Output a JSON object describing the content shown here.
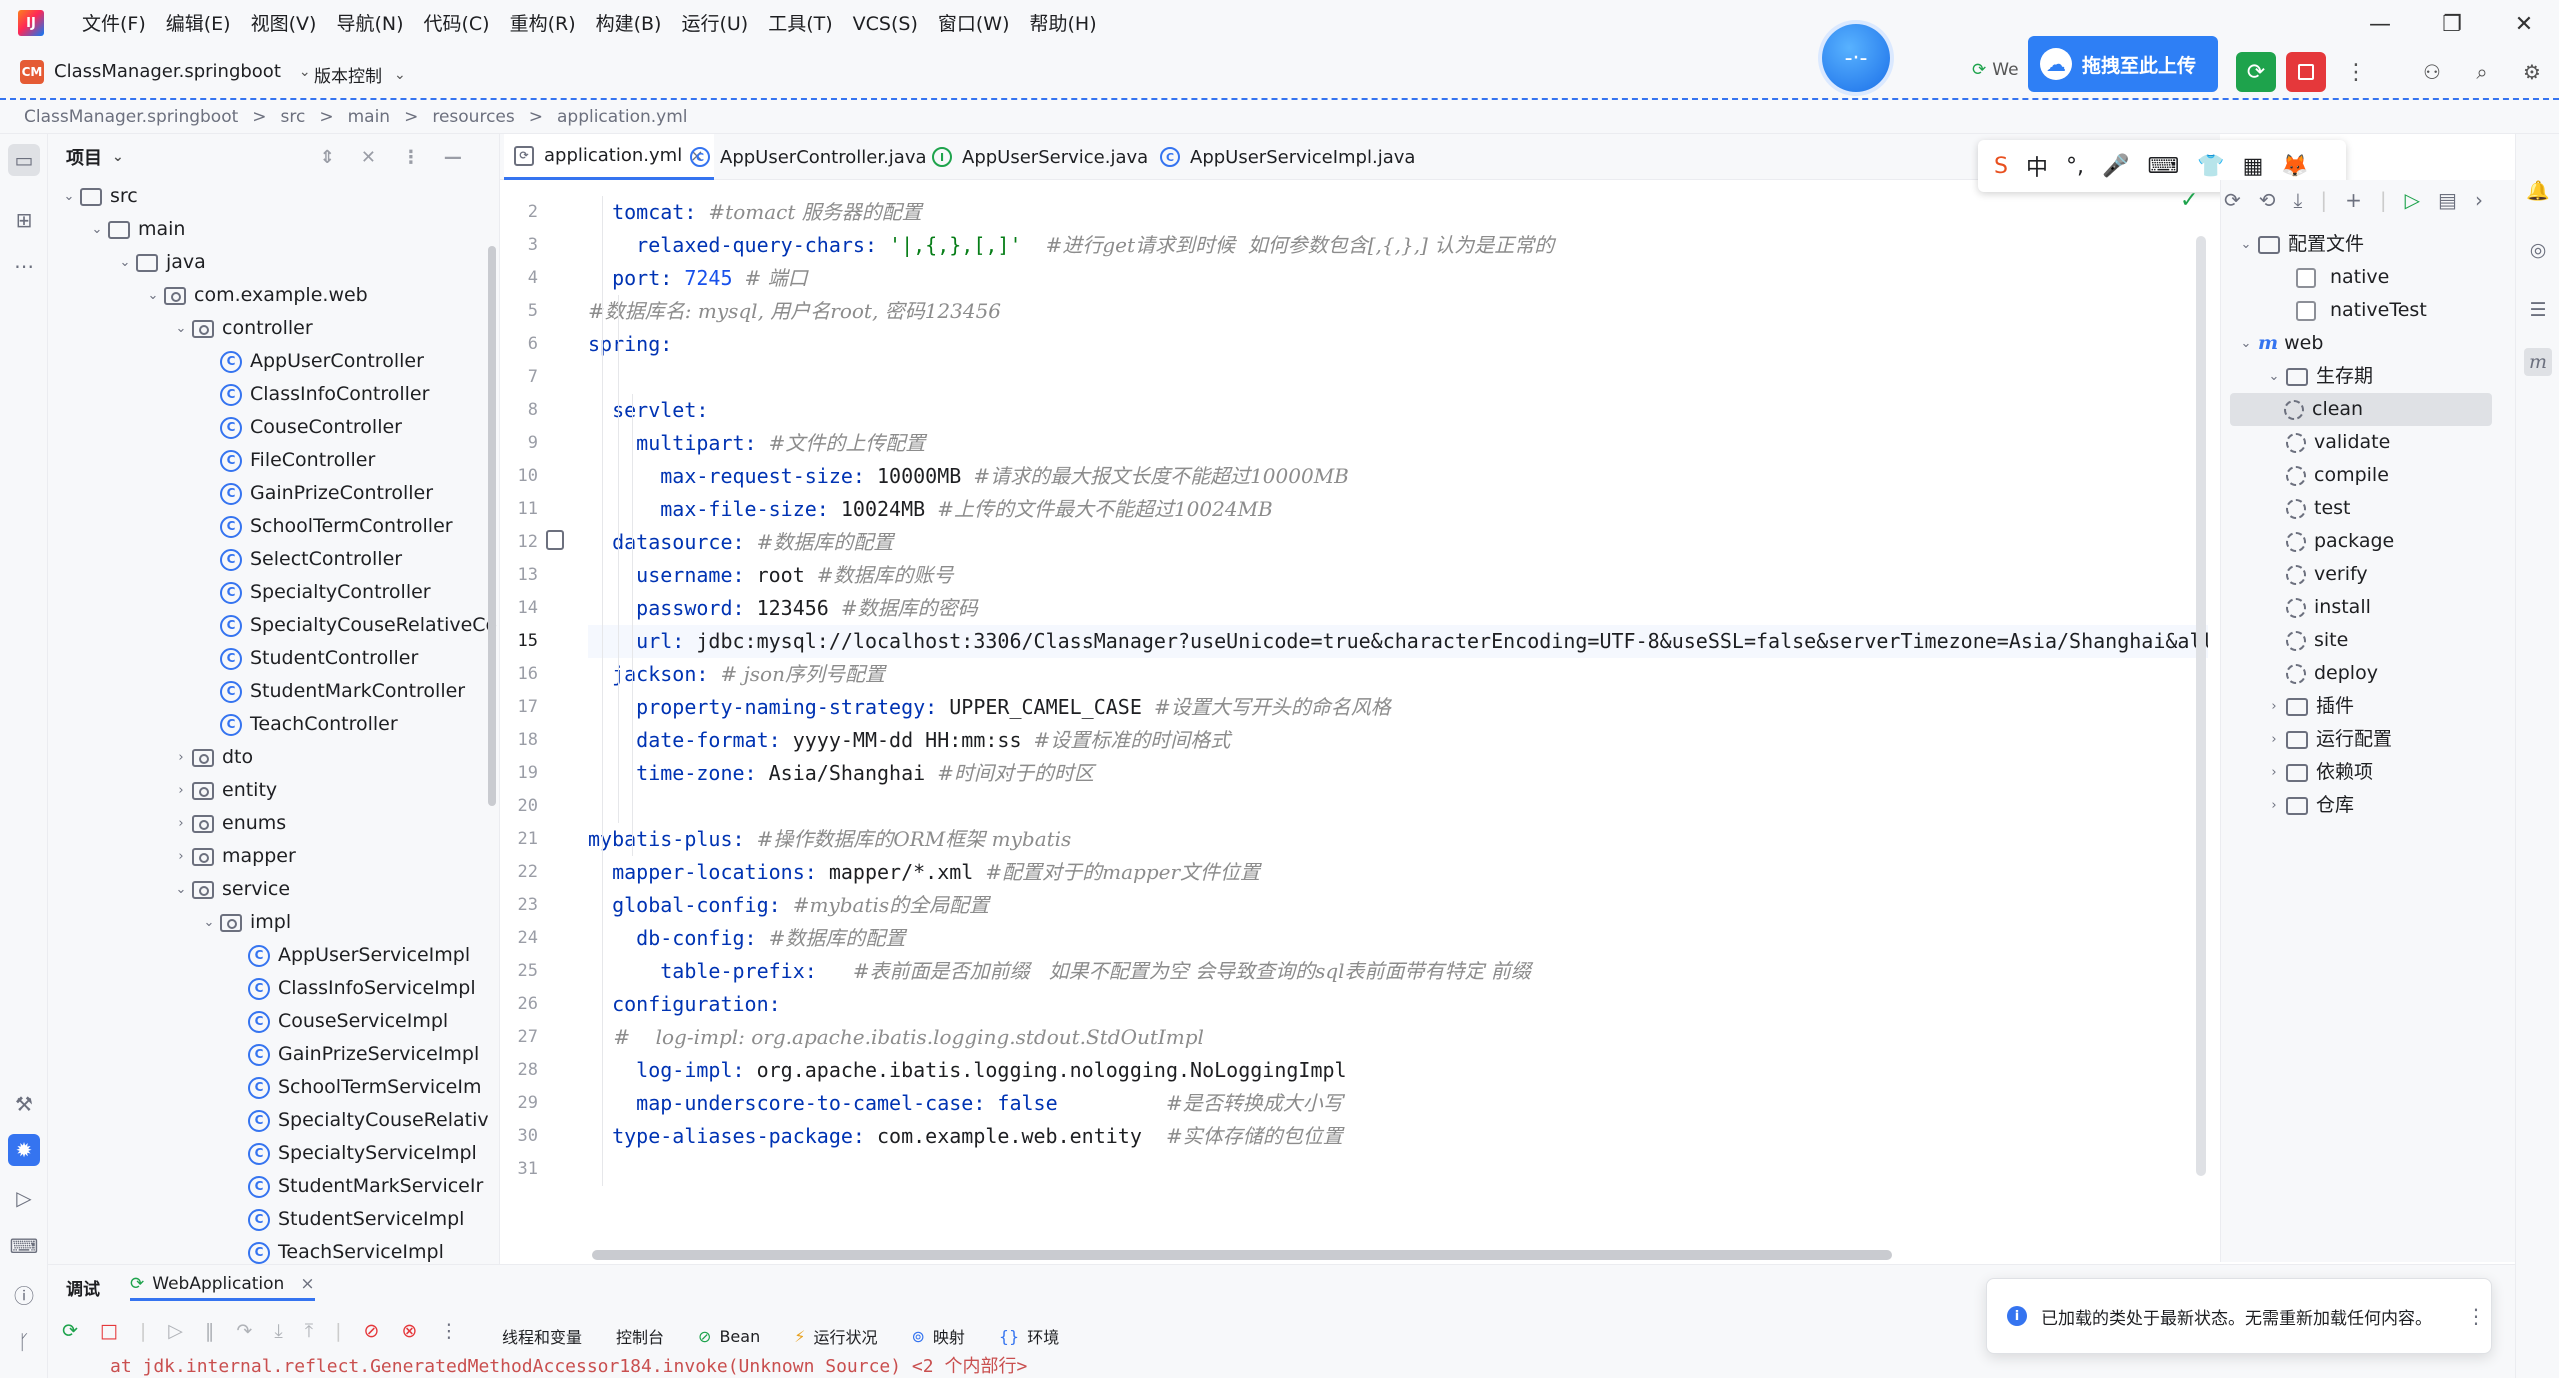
{
  "menubar": {
    "items": [
      "文件(F)",
      "编辑(E)",
      "视图(V)",
      "导航(N)",
      "代码(C)",
      "重构(R)",
      "构建(B)",
      "运行(U)",
      "工具(T)",
      "VCS(S)",
      "窗口(W)",
      "帮助(H)"
    ]
  },
  "toolbar": {
    "project_badge": "CM",
    "project_name": "ClassManager.springboot",
    "vcs_label": "版本控制",
    "run_config_partial": "We",
    "baidu_label": "拖拽至此上传",
    "float_ball_text": "-·-"
  },
  "breadcrumb": [
    "ClassManager.springboot",
    "src",
    "main",
    "resources",
    "application.yml"
  ],
  "project_panel": {
    "title": "项目",
    "tree": [
      {
        "label": "src",
        "depth": 0,
        "kind": "folder",
        "arrow": "open"
      },
      {
        "label": "main",
        "depth": 1,
        "kind": "folder",
        "arrow": "open"
      },
      {
        "label": "java",
        "depth": 2,
        "kind": "folder",
        "arrow": "open"
      },
      {
        "label": "com.example.web",
        "depth": 3,
        "kind": "pkg",
        "arrow": "open"
      },
      {
        "label": "controller",
        "depth": 4,
        "kind": "pkg",
        "arrow": "open"
      },
      {
        "label": "AppUserController",
        "depth": 5,
        "kind": "class"
      },
      {
        "label": "ClassInfoController",
        "depth": 5,
        "kind": "class"
      },
      {
        "label": "CouseController",
        "depth": 5,
        "kind": "class"
      },
      {
        "label": "FileController",
        "depth": 5,
        "kind": "class"
      },
      {
        "label": "GainPrizeController",
        "depth": 5,
        "kind": "class"
      },
      {
        "label": "SchoolTermController",
        "depth": 5,
        "kind": "class"
      },
      {
        "label": "SelectController",
        "depth": 5,
        "kind": "class"
      },
      {
        "label": "SpecialtyController",
        "depth": 5,
        "kind": "class"
      },
      {
        "label": "SpecialtyCouseRelativeCo",
        "depth": 5,
        "kind": "class"
      },
      {
        "label": "StudentController",
        "depth": 5,
        "kind": "class"
      },
      {
        "label": "StudentMarkController",
        "depth": 5,
        "kind": "class"
      },
      {
        "label": "TeachController",
        "depth": 5,
        "kind": "class"
      },
      {
        "label": "dto",
        "depth": 4,
        "kind": "pkg",
        "arrow": "closed"
      },
      {
        "label": "entity",
        "depth": 4,
        "kind": "pkg",
        "arrow": "closed"
      },
      {
        "label": "enums",
        "depth": 4,
        "kind": "pkg",
        "arrow": "closed"
      },
      {
        "label": "mapper",
        "depth": 4,
        "kind": "pkg",
        "arrow": "closed"
      },
      {
        "label": "service",
        "depth": 4,
        "kind": "pkg",
        "arrow": "open"
      },
      {
        "label": "impl",
        "depth": 5,
        "kind": "pkg",
        "arrow": "open"
      },
      {
        "label": "AppUserServiceImpl",
        "depth": 6,
        "kind": "class"
      },
      {
        "label": "ClassInfoServiceImpl",
        "depth": 6,
        "kind": "class"
      },
      {
        "label": "CouseServiceImpl",
        "depth": 6,
        "kind": "class"
      },
      {
        "label": "GainPrizeServiceImpl",
        "depth": 6,
        "kind": "class"
      },
      {
        "label": "SchoolTermServiceIm",
        "depth": 6,
        "kind": "class"
      },
      {
        "label": "SpecialtyCouseRelativ",
        "depth": 6,
        "kind": "class"
      },
      {
        "label": "SpecialtyServiceImpl",
        "depth": 6,
        "kind": "class"
      },
      {
        "label": "StudentMarkServiceIr",
        "depth": 6,
        "kind": "class"
      },
      {
        "label": "StudentServiceImpl",
        "depth": 6,
        "kind": "class"
      },
      {
        "label": "TeachServiceImpl",
        "depth": 6,
        "kind": "class"
      }
    ]
  },
  "editor_tabs": [
    {
      "label": "application.yml",
      "kind": "yml",
      "active": true,
      "close": "×"
    },
    {
      "label": "AppUserController.java",
      "kind": "class",
      "active": false
    },
    {
      "label": "AppUserService.java",
      "kind": "iface",
      "active": false
    },
    {
      "label": "AppUserServiceImpl.java",
      "kind": "class",
      "active": false
    }
  ],
  "ime": {
    "items": [
      "S",
      "中",
      "°,",
      "🎤",
      "⌨",
      "👕",
      "▦",
      "🦊"
    ]
  },
  "editor": {
    "current_line": 15,
    "lines": [
      {
        "n": 2,
        "parts": [
          [
            "k",
            "  tomcat: "
          ],
          [
            "c",
            "#tomact 服务器的配置"
          ]
        ]
      },
      {
        "n": 3,
        "parts": [
          [
            "k",
            "    relaxed-query-chars: "
          ],
          [
            "s",
            "'|,{,},[,]'"
          ],
          [
            "v",
            "  "
          ],
          [
            "c",
            "#进行get请求到时候  如何参数包含[,{,},] 认为是正常的"
          ]
        ]
      },
      {
        "n": 4,
        "parts": [
          [
            "k",
            "  port: "
          ],
          [
            "n",
            "7245"
          ],
          [
            "v",
            " "
          ],
          [
            "c",
            "# 端口"
          ]
        ]
      },
      {
        "n": 5,
        "parts": [
          [
            "c",
            "#数据库名: mysql, 用户名root, 密码123456"
          ]
        ]
      },
      {
        "n": 6,
        "parts": [
          [
            "k",
            "spring:"
          ]
        ]
      },
      {
        "n": 7,
        "parts": []
      },
      {
        "n": 8,
        "parts": [
          [
            "k",
            "  servlet:"
          ]
        ]
      },
      {
        "n": 9,
        "parts": [
          [
            "k",
            "    multipart: "
          ],
          [
            "c",
            "#文件的上传配置"
          ]
        ]
      },
      {
        "n": 10,
        "parts": [
          [
            "k",
            "      max-request-size: "
          ],
          [
            "v",
            "10000MB "
          ],
          [
            "c",
            "#请求的最大报文长度不能超过10000MB"
          ]
        ]
      },
      {
        "n": 11,
        "parts": [
          [
            "k",
            "      max-file-size: "
          ],
          [
            "v",
            "10024MB "
          ],
          [
            "c",
            "#上传的文件最大不能超过10024MB"
          ]
        ]
      },
      {
        "n": 12,
        "parts": [
          [
            "k",
            "  datasource: "
          ],
          [
            "c",
            "#数据库的配置"
          ]
        ]
      },
      {
        "n": 13,
        "parts": [
          [
            "k",
            "    username: "
          ],
          [
            "v",
            "root "
          ],
          [
            "c",
            "#数据库的账号"
          ]
        ]
      },
      {
        "n": 14,
        "parts": [
          [
            "k",
            "    password: "
          ],
          [
            "v",
            "123456 "
          ],
          [
            "c",
            "#数据库的密码"
          ]
        ]
      },
      {
        "n": 15,
        "parts": [
          [
            "k",
            "    url: "
          ],
          [
            "v",
            "jdbc:mysql://localhost:3306/ClassManager?useUnicode=true&characterEncoding=UTF-8&useSSL=false&serverTimezone=Asia/Shanghai&all"
          ]
        ]
      },
      {
        "n": 16,
        "parts": [
          [
            "k",
            "  jackson: "
          ],
          [
            "c",
            "# json序列号配置"
          ]
        ]
      },
      {
        "n": 17,
        "parts": [
          [
            "k",
            "    property-naming-strategy: "
          ],
          [
            "v",
            "UPPER_CAMEL_CASE "
          ],
          [
            "c",
            "#设置大写开头的命名风格"
          ]
        ]
      },
      {
        "n": 18,
        "parts": [
          [
            "k",
            "    date-format: "
          ],
          [
            "v",
            "yyyy-MM-dd HH:mm:ss "
          ],
          [
            "c",
            "#设置标准的时间格式"
          ]
        ]
      },
      {
        "n": 19,
        "parts": [
          [
            "k",
            "    time-zone: "
          ],
          [
            "v",
            "Asia/Shanghai "
          ],
          [
            "c",
            "#时间对于的时区"
          ]
        ]
      },
      {
        "n": 20,
        "parts": []
      },
      {
        "n": 21,
        "parts": [
          [
            "k",
            "mybatis-plus: "
          ],
          [
            "c",
            "#操作数据库的ORM框架 mybatis"
          ]
        ]
      },
      {
        "n": 22,
        "parts": [
          [
            "k",
            "  mapper-locations: "
          ],
          [
            "v",
            "mapper/*.xml "
          ],
          [
            "c",
            "#配置对于的mapper文件位置"
          ]
        ]
      },
      {
        "n": 23,
        "parts": [
          [
            "k",
            "  global-config: "
          ],
          [
            "c",
            "#mybatis的全局配置"
          ]
        ]
      },
      {
        "n": 24,
        "parts": [
          [
            "k",
            "    db-config: "
          ],
          [
            "c",
            "#数据库的配置"
          ]
        ]
      },
      {
        "n": 25,
        "parts": [
          [
            "k",
            "      table-prefix:   "
          ],
          [
            "c",
            "#表前面是否加前缀   如果不配置为空 会导致查询的sql表前面带有特定 前缀"
          ]
        ]
      },
      {
        "n": 26,
        "parts": [
          [
            "k",
            "  configuration:"
          ]
        ]
      },
      {
        "n": 27,
        "parts": [
          [
            "c",
            "    #    log-impl: org.apache.ibatis.logging.stdout.StdOutImpl"
          ]
        ]
      },
      {
        "n": 28,
        "parts": [
          [
            "k",
            "    log-impl: "
          ],
          [
            "v",
            "org.apache.ibatis.logging.nologging.NoLoggingImpl"
          ]
        ]
      },
      {
        "n": 29,
        "parts": [
          [
            "k",
            "    map-underscore-to-camel-case: "
          ],
          [
            "b",
            "false"
          ],
          [
            "v",
            "         "
          ],
          [
            "c",
            "#是否转换成大小写"
          ]
        ]
      },
      {
        "n": 30,
        "parts": [
          [
            "k",
            "  type-aliases-package: "
          ],
          [
            "v",
            "com.example.web.entity  "
          ],
          [
            "c",
            "#实体存储的包位置"
          ]
        ]
      },
      {
        "n": 31,
        "parts": []
      }
    ]
  },
  "maven": {
    "rows": [
      {
        "label": "配置文件",
        "depth": 0,
        "kind": "folder",
        "arrow": "open"
      },
      {
        "label": "native",
        "depth": 1,
        "kind": "checkbox"
      },
      {
        "label": "nativeTest",
        "depth": 1,
        "kind": "checkbox"
      },
      {
        "label": "web",
        "depth": 0,
        "kind": "maven",
        "arrow": "open"
      },
      {
        "label": "生存期",
        "depth": 1,
        "kind": "folder",
        "arrow": "open"
      },
      {
        "label": "clean",
        "depth": 2,
        "kind": "goal",
        "selected": true
      },
      {
        "label": "validate",
        "depth": 2,
        "kind": "goal"
      },
      {
        "label": "compile",
        "depth": 2,
        "kind": "goal"
      },
      {
        "label": "test",
        "depth": 2,
        "kind": "goal"
      },
      {
        "label": "package",
        "depth": 2,
        "kind": "goal"
      },
      {
        "label": "verify",
        "depth": 2,
        "kind": "goal"
      },
      {
        "label": "install",
        "depth": 2,
        "kind": "goal"
      },
      {
        "label": "site",
        "depth": 2,
        "kind": "goal"
      },
      {
        "label": "deploy",
        "depth": 2,
        "kind": "goal"
      },
      {
        "label": "插件",
        "depth": 1,
        "kind": "folder",
        "arrow": "closed"
      },
      {
        "label": "运行配置",
        "depth": 1,
        "kind": "folder",
        "arrow": "closed"
      },
      {
        "label": "依赖项",
        "depth": 1,
        "kind": "folder",
        "arrow": "closed"
      },
      {
        "label": "仓库",
        "depth": 1,
        "kind": "folder",
        "arrow": "closed"
      }
    ]
  },
  "debug": {
    "tab_debug": "调试",
    "tab_app": "WebApplication",
    "subtabs": [
      "线程和变量",
      "控制台",
      "Bean",
      "运行状况",
      "映射",
      "环境"
    ],
    "log_partial": "at jdk.internal.reflect.GeneratedMethodAccessor184.invoke(Unknown Source) <2 个内部行>"
  },
  "notification": {
    "text": "已加载的类处于最新状态。无需重新加载任何内容。"
  },
  "colors": {
    "accent": "#3574f0",
    "keyword": "#0033b3",
    "string": "#067d17",
    "number": "#1750eb",
    "comment": "#8c8c8c",
    "baidu": "#2e7ff5",
    "run_green": "#1ea34c",
    "stop_red": "#e5383b"
  }
}
